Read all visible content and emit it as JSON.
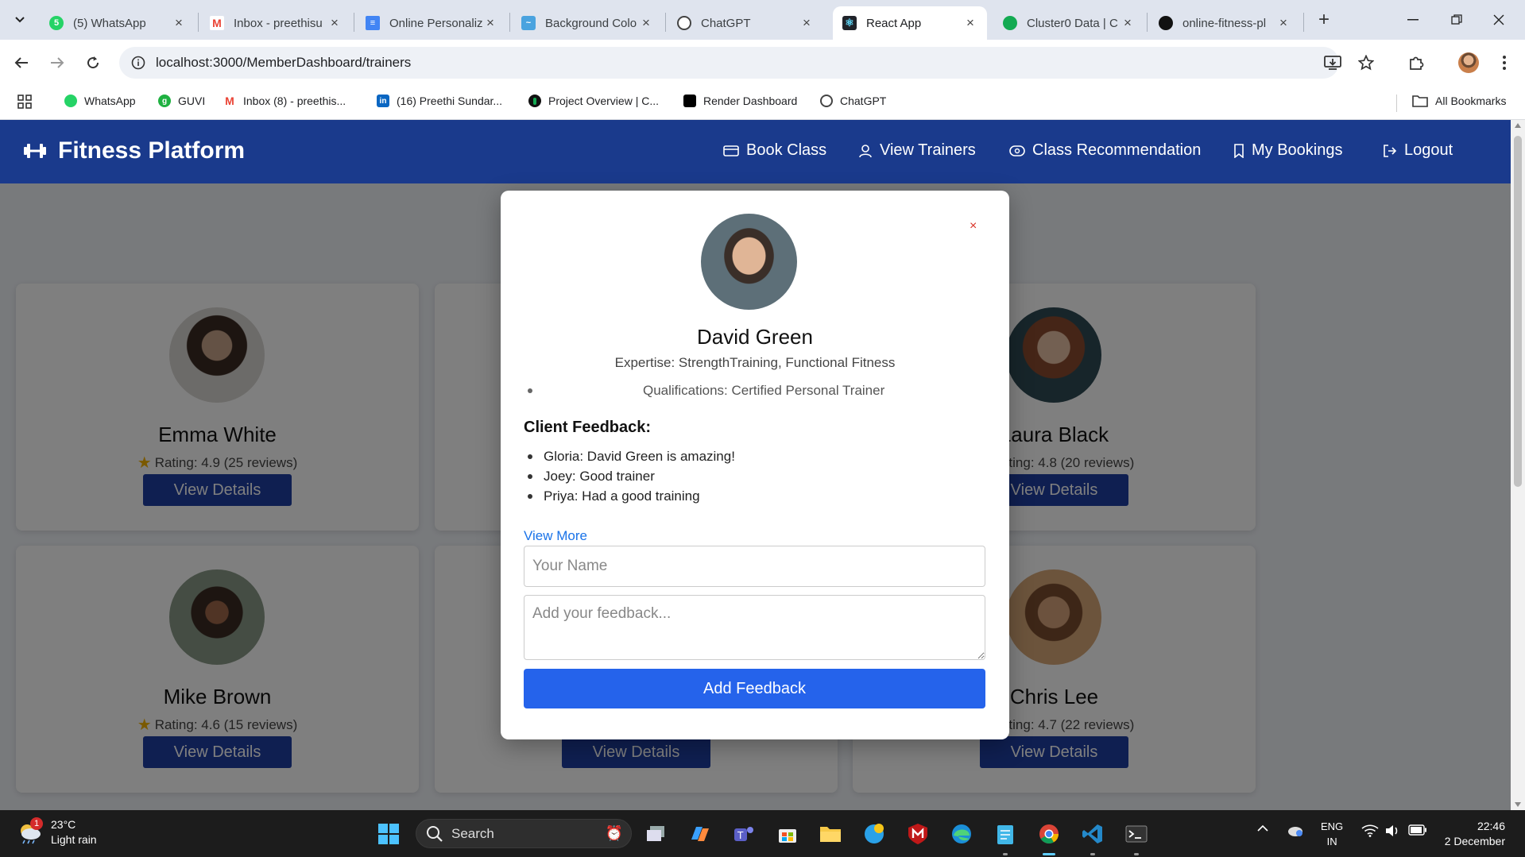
{
  "browser": {
    "tabs": [
      {
        "title": "(5) WhatsApp",
        "icon": "whatsapp-icon",
        "color": "#25d366",
        "badge": "5"
      },
      {
        "title": "Inbox - preethisu",
        "icon": "gmail-icon",
        "color": "#ea4335"
      },
      {
        "title": "Online Personaliz",
        "icon": "docs-icon",
        "color": "#4285f4"
      },
      {
        "title": "Background Colo",
        "icon": "site-icon",
        "color": "#4aa3df"
      },
      {
        "title": "ChatGPT",
        "icon": "chatgpt-icon",
        "color": "#444444"
      },
      {
        "title": "React App",
        "icon": "react-icon",
        "color": "#61dafb",
        "active": true
      },
      {
        "title": "Cluster0 Data | C",
        "icon": "mongodb-icon",
        "color": "#13aa52"
      },
      {
        "title": "online-fitness-pl",
        "icon": "github-icon",
        "color": "#111111"
      }
    ],
    "url": "localhost:3000/MemberDashboard/trainers",
    "bookmarks": [
      {
        "label": "WhatsApp",
        "icon": "whatsapp-icon",
        "color": "#25d366"
      },
      {
        "label": "GUVI",
        "icon": "guvi-icon",
        "color": "#1fb141"
      },
      {
        "label": "Inbox (8) - preethis...",
        "icon": "gmail-icon",
        "color": "#ea4335"
      },
      {
        "label": "(16) Preethi Sundar...",
        "icon": "linkedin-icon",
        "color": "#0a66c2"
      },
      {
        "label": "Project Overview | C...",
        "icon": "mongodb-icon",
        "color": "#13aa52"
      },
      {
        "label": "Render Dashboard",
        "icon": "render-icon",
        "color": "#000000"
      },
      {
        "label": "ChatGPT",
        "icon": "chatgpt-icon",
        "color": "#444444"
      }
    ],
    "all_bookmarks": "All Bookmarks"
  },
  "app": {
    "brand": "Fitness Platform",
    "nav": [
      {
        "label": "Book Class",
        "icon": "class-icon"
      },
      {
        "label": "View Trainers",
        "icon": "trainers-icon"
      },
      {
        "label": "Class Recommendation",
        "icon": "recommendation-icon"
      },
      {
        "label": "My Bookings",
        "icon": "bookmark-icon"
      },
      {
        "label": "Logout",
        "icon": "logout-icon"
      }
    ],
    "trainers": [
      {
        "name": "Emma White",
        "rating": "Rating: 4.9 (25 reviews)",
        "button": "View Details"
      },
      {
        "name": "Laura Black",
        "rating": "Rating: 4.8 (20 reviews)",
        "button": "View Details"
      },
      {
        "name": "Mike Brown",
        "rating": "Rating: 4.6 (15 reviews)",
        "button": "View Details"
      },
      {
        "name": "",
        "rating": "",
        "button": "View Details"
      },
      {
        "name": "Chris Lee",
        "rating": "Rating: 4.7 (22 reviews)",
        "button": "View Details"
      }
    ],
    "modal": {
      "close": "×",
      "name": "David Green",
      "expertise": "Expertise: StrengthTraining, Functional Fitness",
      "qualifications": "Qualifications: Certified Personal Trainer",
      "feedback_title": "Client Feedback:",
      "feedback": [
        "Gloria: David Green is amazing!",
        "Joey: Good trainer",
        "Priya: Had a good training"
      ],
      "view_more": "View More",
      "name_placeholder": "Your Name",
      "feedback_placeholder": "Add your feedback...",
      "add_button": "Add Feedback"
    }
  },
  "taskbar": {
    "weather_temp": "23°C",
    "weather_desc": "Light rain",
    "weather_badge": "1",
    "search": "Search",
    "lang1": "ENG",
    "lang2": "IN",
    "time": "22:46",
    "date": "2 December"
  }
}
